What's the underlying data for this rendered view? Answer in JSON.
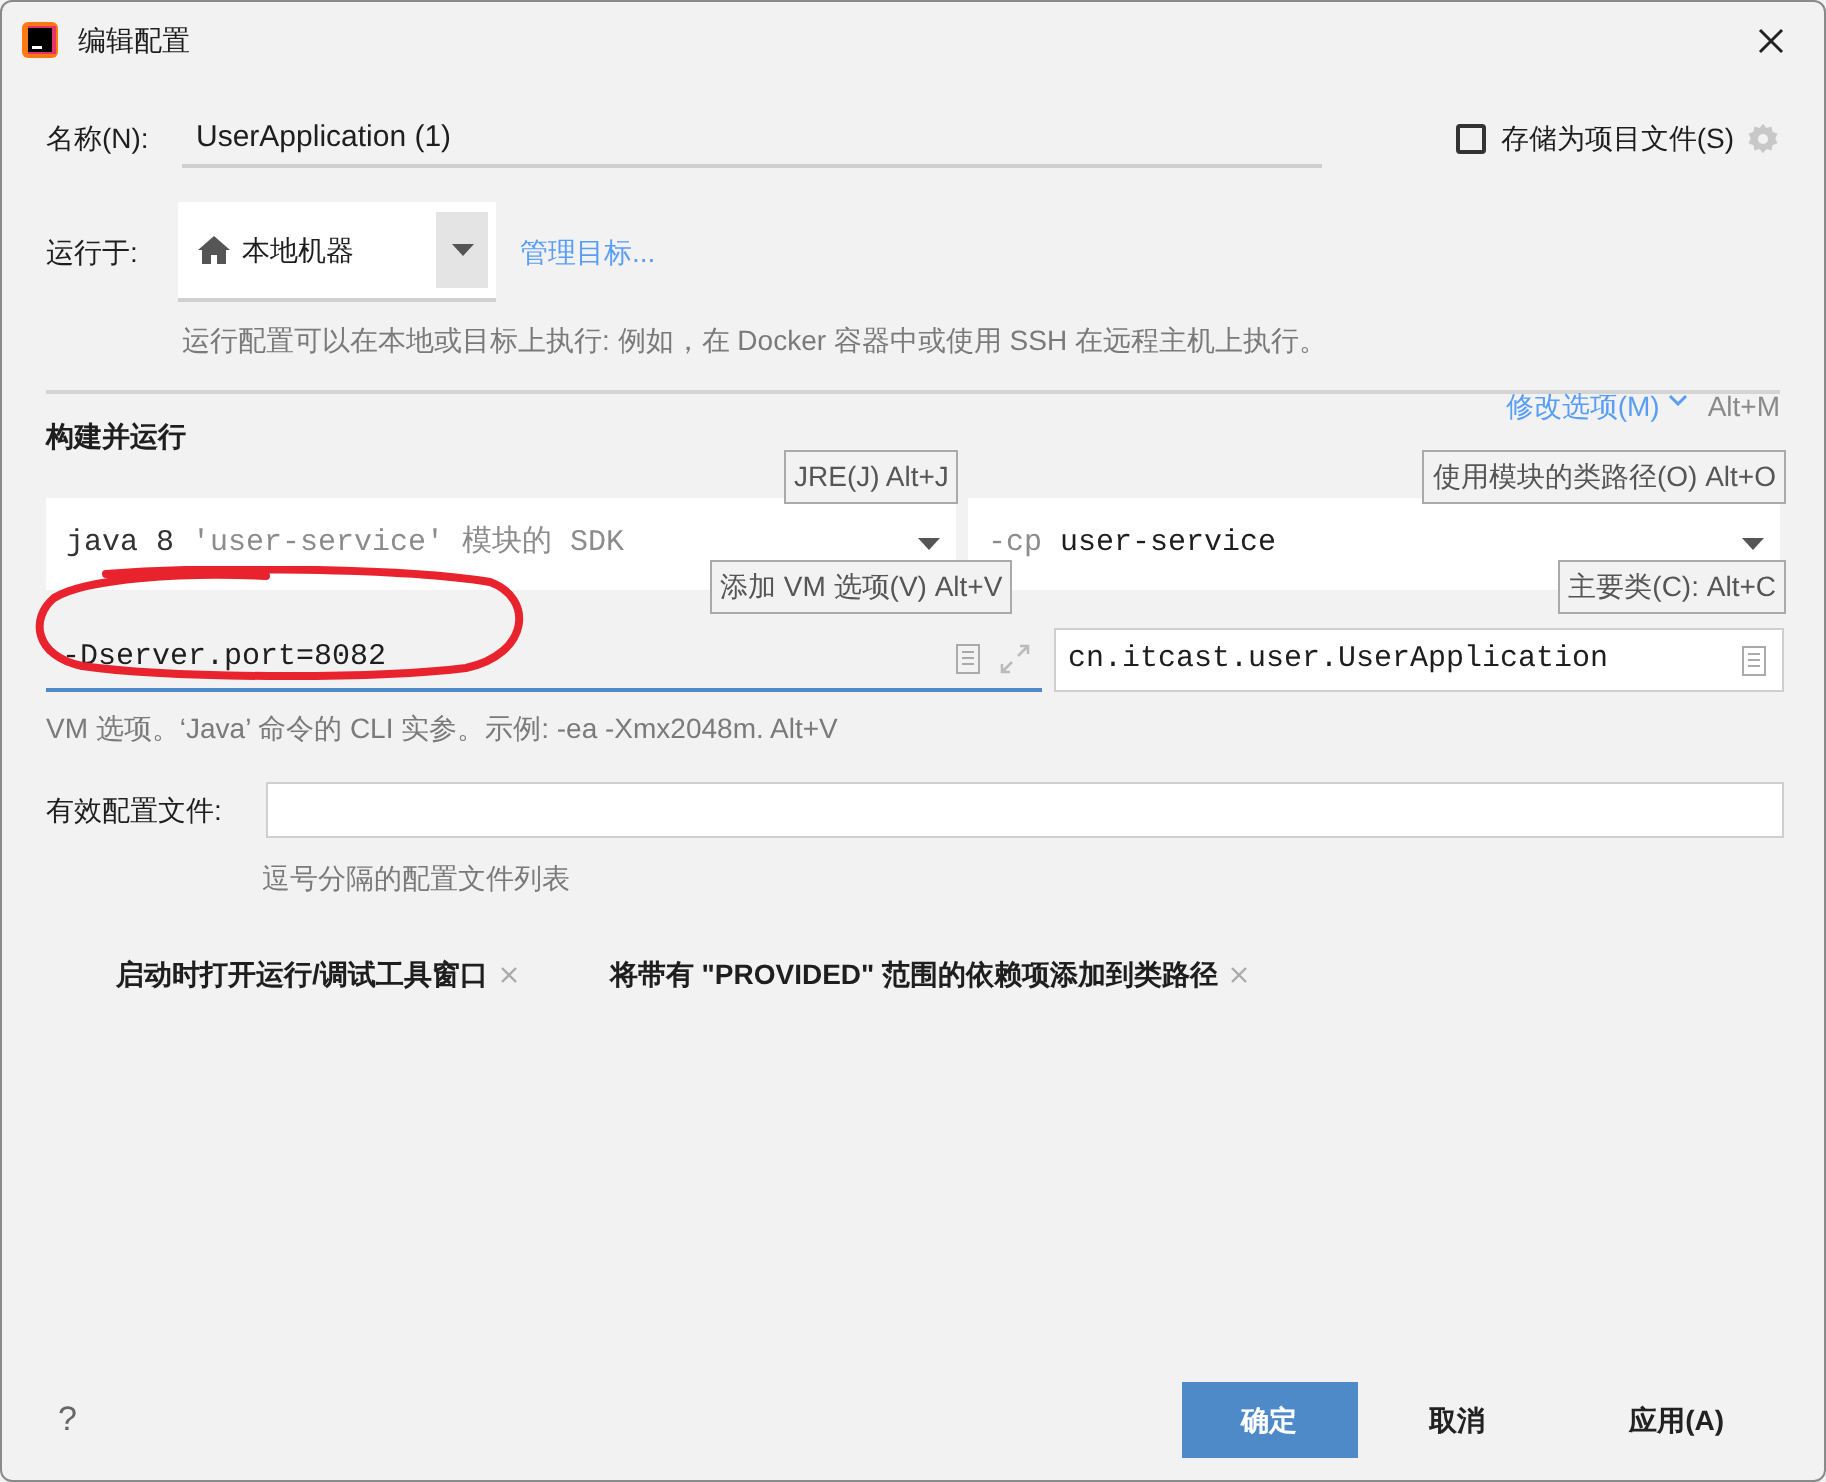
{
  "window": {
    "title": "编辑配置"
  },
  "name_field": {
    "label": "名称(N):",
    "value": "UserApplication (1)"
  },
  "store_as_project_file": {
    "label": "存储为项目文件(S)",
    "checked": false
  },
  "run_on": {
    "label": "运行于:",
    "value": "本地机器",
    "link": "管理目标...",
    "hint": "运行配置可以在本地或目标上执行: 例如，在 Docker 容器中或使用 SSH 在远程主机上执行。"
  },
  "build_section": {
    "title": "构建并运行",
    "modify_options": "修改选项(M)",
    "modify_shortcut": "Alt+M"
  },
  "jre": {
    "value": "java 8",
    "module_text": "'user-service' 模块的 SDK",
    "hint": "JRE(J) Alt+J"
  },
  "classpath": {
    "prefix": "-cp",
    "value": "user-service",
    "hint": "使用模块的类路径(O) Alt+O"
  },
  "vm_options": {
    "value": "-Dserver.port=8082",
    "hint": "添加 VM 选项(V) Alt+V",
    "help": "VM 选项。‘Java’ 命令的 CLI 实参。示例: -ea -Xmx2048m. Alt+V"
  },
  "main_class": {
    "value": "cn.itcast.user.UserApplication",
    "hint": "主要类(C): Alt+C"
  },
  "profiles": {
    "label": "有效配置文件:",
    "hint": "逗号分隔的配置文件列表"
  },
  "tags": [
    {
      "label": "启动时打开运行/调试工具窗口"
    },
    {
      "label": "将带有 \"PROVIDED\" 范围的依赖项添加到类路径"
    }
  ],
  "help": "?",
  "buttons": [
    {
      "label": "确定",
      "kind": "primary"
    },
    {
      "label": "取消",
      "kind": "default"
    },
    {
      "label": "应用(A)",
      "kind": "default"
    }
  ]
}
